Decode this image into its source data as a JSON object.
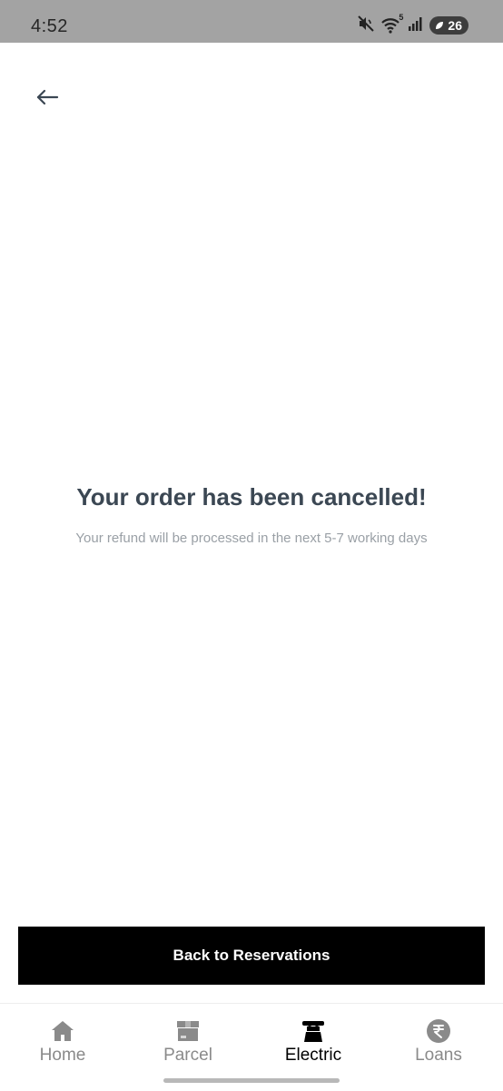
{
  "status_bar": {
    "time": "4:52",
    "battery_level": "26",
    "network_badge": "5",
    "icons": [
      "mute-icon",
      "wifi-icon",
      "signal-icon",
      "battery-icon"
    ]
  },
  "header": {
    "back_icon": "arrow-left-icon"
  },
  "message": {
    "title": "Your order has been cancelled!",
    "subtitle": "Your refund will be processed in the next 5-7 working days"
  },
  "actions": {
    "primary_label": "Back to Reservations"
  },
  "bottom_nav": {
    "items": [
      {
        "label": "Home",
        "icon": "home-icon",
        "active": false
      },
      {
        "label": "Parcel",
        "icon": "parcel-icon",
        "active": false
      },
      {
        "label": "Electric",
        "icon": "electric-icon",
        "active": true
      },
      {
        "label": "Loans",
        "icon": "rupee-icon",
        "active": false
      }
    ]
  },
  "colors": {
    "status_bar": "#a3a3a3",
    "title": "#3b4753",
    "subtitle": "#9aa0a6",
    "button": "#000000",
    "nav_inactive": "#8a8a8a",
    "nav_active": "#000000"
  }
}
